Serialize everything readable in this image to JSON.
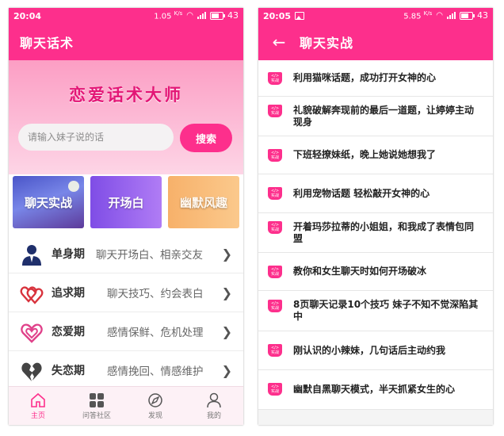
{
  "left": {
    "status": {
      "time": "20:04",
      "net": "1.05",
      "net_unit": "K/s",
      "battery": "43"
    },
    "appbar_title": "聊天话术",
    "banner_title": "恋爱话术大师",
    "search": {
      "placeholder": "请输入妹子说的话",
      "button": "搜索"
    },
    "cards": [
      "聊天实战",
      "开场白",
      "幽默风趣"
    ],
    "stages": [
      {
        "name": "单身期",
        "desc": "聊天开场白、相亲交友",
        "icon": "person-suit-icon"
      },
      {
        "name": "追求期",
        "desc": "聊天技巧、约会表白",
        "icon": "double-heart-icon"
      },
      {
        "name": "恋爱期",
        "desc": "感情保鲜、危机处理",
        "icon": "heart-outline-icon"
      },
      {
        "name": "失恋期",
        "desc": "感情挽回、情感维护",
        "icon": "broken-heart-icon"
      }
    ],
    "tabs": [
      {
        "label": "主页",
        "icon": "home-icon",
        "active": true
      },
      {
        "label": "问答社区",
        "icon": "grid-icon",
        "active": false
      },
      {
        "label": "发现",
        "icon": "compass-icon",
        "active": false
      },
      {
        "label": "我的",
        "icon": "user-icon",
        "active": false
      }
    ]
  },
  "right": {
    "status": {
      "time": "20:05",
      "net": "5.85",
      "net_unit": "K/s",
      "battery": "43"
    },
    "appbar_title": "聊天实战",
    "badge_top": "</>",
    "badge_bottom": "实战",
    "articles": [
      "利用猫咪话题，成功打开女神的心",
      "礼貌破解奔现前的最后一道题，让婷婷主动现身",
      "下班轻撩妹纸，晚上她说她想我了",
      "利用宠物话题 轻松敲开女神的心",
      "开着玛莎拉蒂的小姐姐，和我成了表情包同盟",
      "教你和女生聊天时如何开场破冰",
      "8页聊天记录10个技巧 妹子不知不觉深陷其中",
      "刚认识的小辣妹，几句话后主动约我",
      "幽默自黑聊天模式，半天抓紧女生的心"
    ]
  },
  "colors": {
    "primary": "#fd2f8c",
    "banner_top": "#fc9ec4",
    "banner_bottom": "#fdd5e6"
  }
}
